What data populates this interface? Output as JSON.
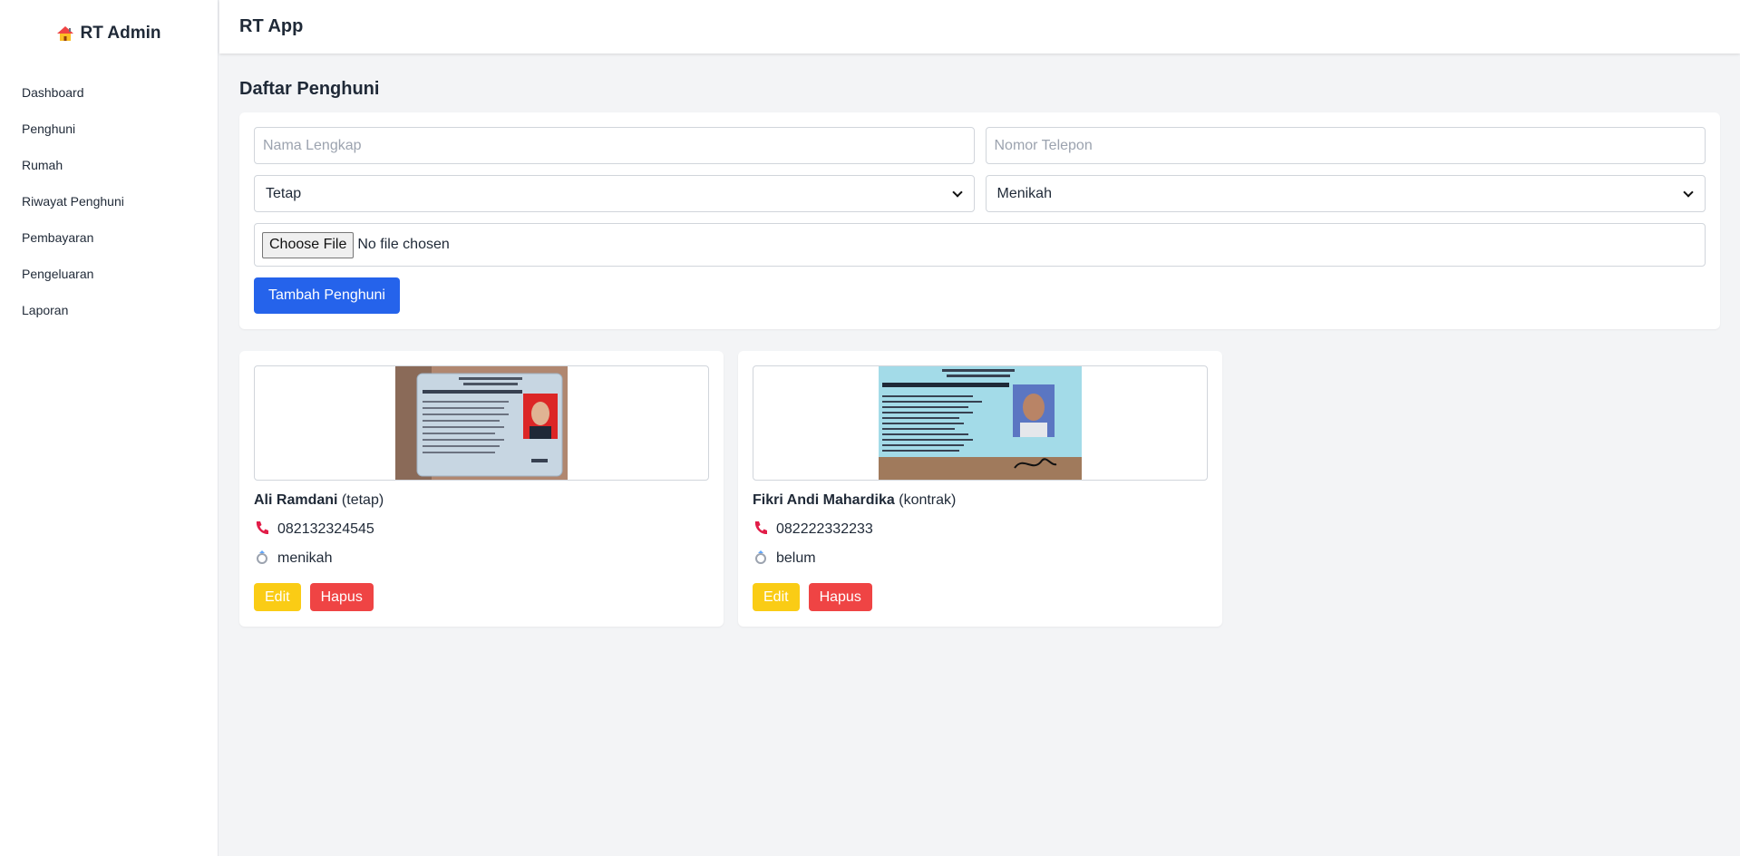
{
  "brand": {
    "title": "RT Admin",
    "icon": "house-icon"
  },
  "sidebar": {
    "items": [
      {
        "label": "Dashboard"
      },
      {
        "label": "Penghuni"
      },
      {
        "label": "Rumah"
      },
      {
        "label": "Riwayat Penghuni"
      },
      {
        "label": "Pembayaran"
      },
      {
        "label": "Pengeluaran"
      },
      {
        "label": "Laporan"
      }
    ]
  },
  "topbar": {
    "title": "RT App"
  },
  "page": {
    "title": "Daftar Penghuni"
  },
  "form": {
    "name_placeholder": "Nama Lengkap",
    "phone_placeholder": "Nomor Telepon",
    "status_value": "Tetap",
    "marital_value": "Menikah",
    "file_button": "Choose File",
    "file_status": "No file chosen",
    "submit_label": "Tambah Penghuni"
  },
  "residents": [
    {
      "name": "Ali Ramdani",
      "type": "(tetap)",
      "phone": "082132324545",
      "marital": "menikah",
      "edit_label": "Edit",
      "delete_label": "Hapus"
    },
    {
      "name": "Fikri Andi Mahardika",
      "type": "(kontrak)",
      "phone": "082222332233",
      "marital": "belum",
      "edit_label": "Edit",
      "delete_label": "Hapus"
    }
  ],
  "colors": {
    "primary": "#2563eb",
    "edit": "#facc15",
    "delete": "#ef4444",
    "background": "#f3f4f6"
  }
}
